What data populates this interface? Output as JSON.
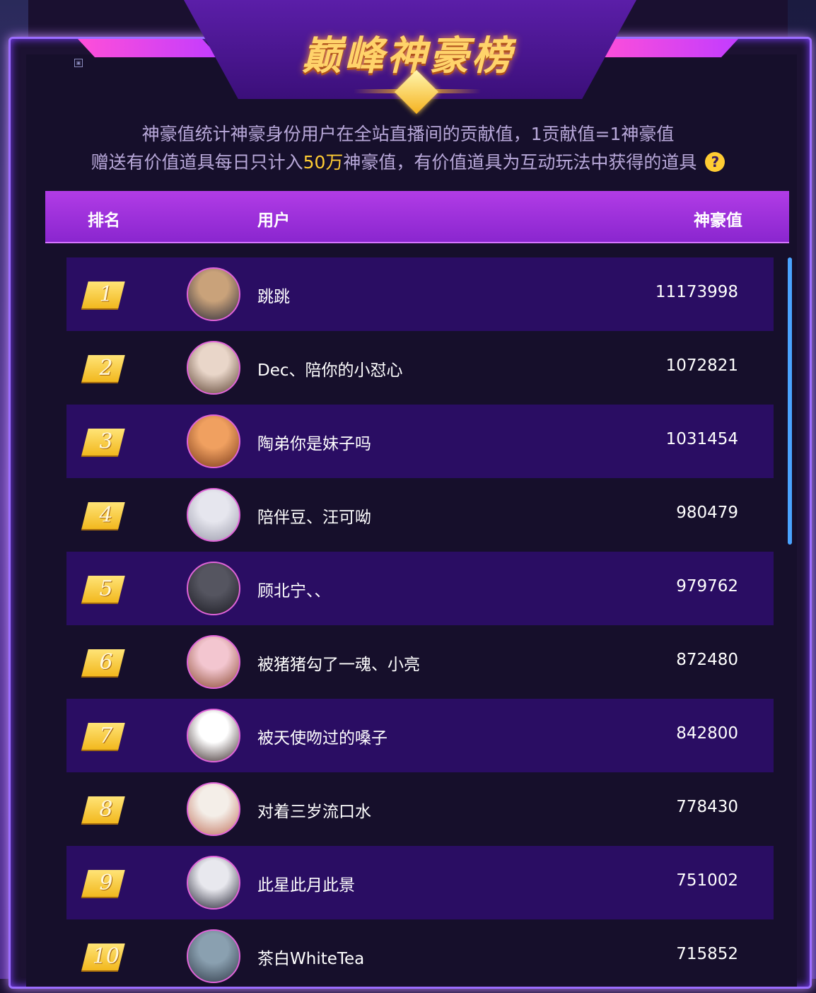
{
  "title": "巅峰神豪榜",
  "description": {
    "line1": "神豪值统计神豪身份用户在全站直播间的贡献值，1贡献值=1神豪值",
    "line2_before": "赠送有价值道具每日只计入",
    "line2_highlight": "50万",
    "line2_after": "神豪值，有价值道具为互动玩法中获得的道具",
    "help_icon": "question-icon",
    "help_symbol": "?"
  },
  "table": {
    "headers": {
      "rank": "排名",
      "user": "用户",
      "value": "神豪值"
    },
    "rows": [
      {
        "rank": "1",
        "name": "跳跳",
        "value": "11173998",
        "avatar_colors": [
          "#c9a27a",
          "#2a2a3a"
        ]
      },
      {
        "rank": "2",
        "name": "Dec、陪你的小怼心",
        "value": "1072821",
        "avatar_colors": [
          "#e9d6c9",
          "#5a4030"
        ]
      },
      {
        "rank": "3",
        "name": "陶弟你是妹子吗",
        "value": "1031454",
        "avatar_colors": [
          "#f0a060",
          "#7a3a1a"
        ]
      },
      {
        "rank": "4",
        "name": "陪伴豆、汪可呦",
        "value": "980479",
        "avatar_colors": [
          "#e6e6ee",
          "#9a9aaa"
        ]
      },
      {
        "rank": "5",
        "name": "顾北宁、、",
        "value": "979762",
        "avatar_colors": [
          "#555560",
          "#1a1a22"
        ]
      },
      {
        "rank": "6",
        "name": "被猪猪勾了一魂、小亮",
        "value": "872480",
        "avatar_colors": [
          "#f3c6d0",
          "#8a4a30"
        ]
      },
      {
        "rank": "7",
        "name": "被天使吻过的嗓子",
        "value": "842800",
        "avatar_colors": [
          "#ffffff",
          "#3a2a2a"
        ]
      },
      {
        "rank": "8",
        "name": "对着三岁流口水",
        "value": "778430",
        "avatar_colors": [
          "#f4eee8",
          "#c0705a"
        ]
      },
      {
        "rank": "9",
        "name": "此星此月此景",
        "value": "751002",
        "avatar_colors": [
          "#e8e8ee",
          "#202030"
        ]
      },
      {
        "rank": "10",
        "name": "茶白WhiteTea",
        "value": "715852",
        "avatar_colors": [
          "#8aa0b0",
          "#303a48"
        ]
      }
    ]
  },
  "colors": {
    "accent_gold": "#ffcc33",
    "header_purple": "#a233de",
    "row_purple": "#2a0d63",
    "scroll_blue": "#4aa3ff"
  }
}
